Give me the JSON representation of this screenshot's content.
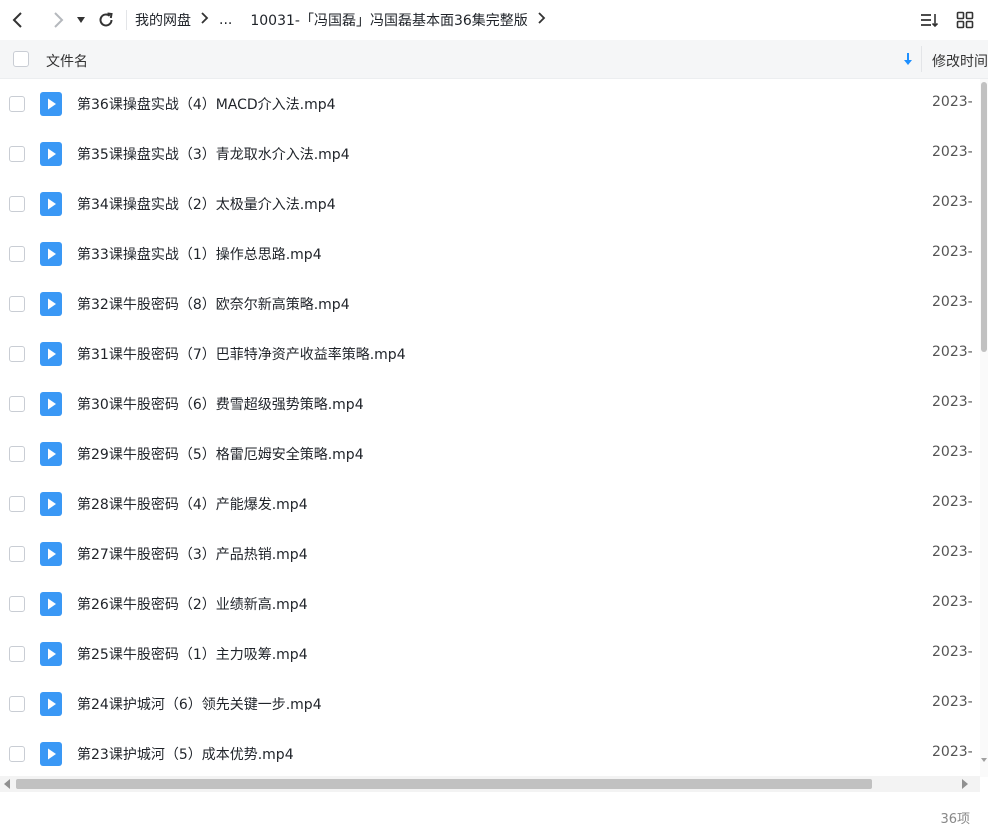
{
  "breadcrumb": {
    "root": "我的网盘",
    "ellipsis": "...",
    "current": "10031-「冯国磊」冯国磊基本面36集完整版"
  },
  "header": {
    "name_label": "文件名",
    "date_label": "修改时间"
  },
  "files": [
    {
      "name": "第36课操盘实战（4）MACD介入法.mp4",
      "date": "2023-"
    },
    {
      "name": "第35课操盘实战（3）青龙取水介入法.mp4",
      "date": "2023-"
    },
    {
      "name": "第34课操盘实战（2）太极量介入法.mp4",
      "date": "2023-"
    },
    {
      "name": "第33课操盘实战（1）操作总思路.mp4",
      "date": "2023-"
    },
    {
      "name": "第32课牛股密码（8）欧奈尔新高策略.mp4",
      "date": "2023-"
    },
    {
      "name": "第31课牛股密码（7）巴菲特净资产收益率策略.mp4",
      "date": "2023-"
    },
    {
      "name": "第30课牛股密码（6）费雪超级强势策略.mp4",
      "date": "2023-"
    },
    {
      "name": "第29课牛股密码（5）格雷厄姆安全策略.mp4",
      "date": "2023-"
    },
    {
      "name": "第28课牛股密码（4）产能爆发.mp4",
      "date": "2023-"
    },
    {
      "name": "第27课牛股密码（3）产品热销.mp4",
      "date": "2023-"
    },
    {
      "name": "第26课牛股密码（2）业绩新高.mp4",
      "date": "2023-"
    },
    {
      "name": "第25课牛股密码（1）主力吸筹.mp4",
      "date": "2023-"
    },
    {
      "name": "第24课护城河（6）领先关键一步.mp4",
      "date": "2023-"
    },
    {
      "name": "第23课护城河（5）成本优势.mp4",
      "date": "2023-"
    }
  ],
  "footer": {
    "count": "36项"
  },
  "colors": {
    "accent": "#1e90ff",
    "video_icon": "#3a98f5"
  },
  "icons": {
    "back": "back-arrow-icon",
    "forward": "forward-arrow-icon",
    "history": "dropdown-triangle-icon",
    "refresh": "refresh-icon",
    "sort": "sort-lines-icon",
    "grid": "grid-view-icon",
    "file": "video-file-icon"
  }
}
